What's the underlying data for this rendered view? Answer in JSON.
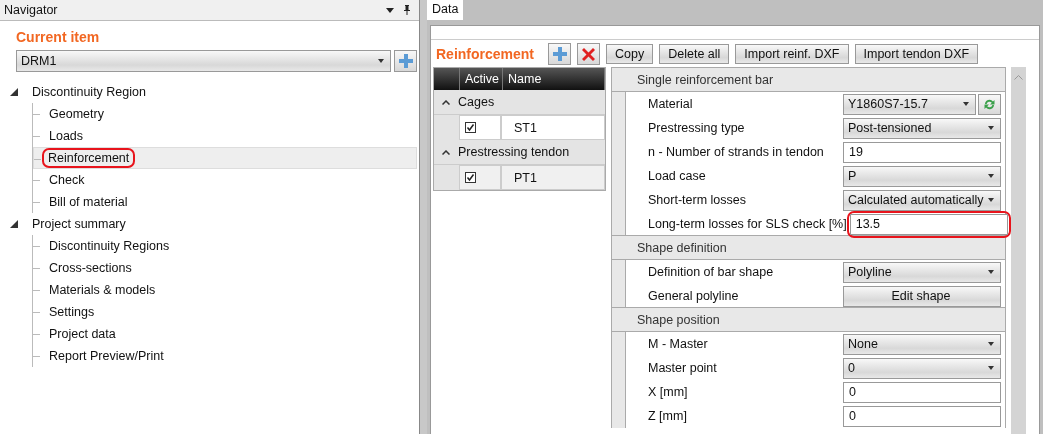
{
  "navigator": {
    "title": "Navigator",
    "current_item_label": "Current item",
    "current_item_value": "DRM1",
    "tree": [
      {
        "label": "Discontinuity Region",
        "expanded": true,
        "selected": false,
        "highlighted": false,
        "children": [
          {
            "label": "Geometry",
            "selected": false,
            "highlighted": false
          },
          {
            "label": "Loads",
            "selected": false,
            "highlighted": false
          },
          {
            "label": "Reinforcement",
            "selected": true,
            "highlighted": true
          },
          {
            "label": "Check",
            "selected": false,
            "highlighted": false
          },
          {
            "label": "Bill of material",
            "selected": false,
            "highlighted": false
          }
        ]
      },
      {
        "label": "Project summary",
        "expanded": true,
        "selected": false,
        "highlighted": false,
        "children": [
          {
            "label": "Discontinuity Regions",
            "selected": false,
            "highlighted": false
          },
          {
            "label": "Cross-sections",
            "selected": false,
            "highlighted": false
          },
          {
            "label": "Materials & models",
            "selected": false,
            "highlighted": false
          },
          {
            "label": "Settings",
            "selected": false,
            "highlighted": false
          },
          {
            "label": "Project data",
            "selected": false,
            "highlighted": false
          },
          {
            "label": "Report Preview/Print",
            "selected": false,
            "highlighted": false
          }
        ]
      }
    ]
  },
  "data_panel": {
    "tabs": [
      {
        "label": "Data",
        "selected": true
      }
    ],
    "title": "Reinforcement",
    "toolbar": [
      {
        "kind": "add"
      },
      {
        "kind": "delete"
      },
      {
        "kind": "text",
        "label": "Copy"
      },
      {
        "kind": "text",
        "label": "Delete all"
      },
      {
        "kind": "text",
        "label": "Import reinf. DXF"
      },
      {
        "kind": "text",
        "label": "Import tendon DXF"
      }
    ],
    "table": {
      "columns": [
        "Active",
        "Name"
      ],
      "groups": [
        {
          "label": "Cages",
          "expanded": true,
          "rows": [
            {
              "active": true,
              "name": "ST1",
              "selected": false
            }
          ]
        },
        {
          "label": "Prestressing tendon",
          "expanded": true,
          "rows": [
            {
              "active": true,
              "name": "PT1",
              "selected": true
            }
          ]
        }
      ]
    },
    "properties": [
      {
        "kind": "section",
        "label": "Single reinforcement bar"
      },
      {
        "kind": "dropdown",
        "label": "Material",
        "value": "Y1860S7-15.7",
        "refresh": true,
        "highlighted": false
      },
      {
        "kind": "dropdown",
        "label": "Prestressing type",
        "value": "Post-tensioned",
        "highlighted": false
      },
      {
        "kind": "text",
        "label": "n - Number of strands in tendon",
        "value": "19",
        "highlighted": false
      },
      {
        "kind": "dropdown",
        "label": "Load case",
        "value": "P",
        "highlighted": false
      },
      {
        "kind": "dropdown",
        "label": "Short-term losses",
        "value": "Calculated automatically",
        "highlighted": false
      },
      {
        "kind": "text",
        "label": "Long-term losses for SLS check [%]",
        "value": "13.5",
        "highlighted": true
      },
      {
        "kind": "section",
        "label": "Shape definition"
      },
      {
        "kind": "dropdown",
        "label": "Definition of bar shape",
        "value": "Polyline",
        "highlighted": false
      },
      {
        "kind": "button",
        "label": "General polyline",
        "value": "Edit shape",
        "highlighted": false
      },
      {
        "kind": "section",
        "label": "Shape position"
      },
      {
        "kind": "dropdown",
        "label": "M - Master",
        "value": "None",
        "highlighted": false
      },
      {
        "kind": "dropdown",
        "label": "Master point",
        "value": "0",
        "highlighted": false
      },
      {
        "kind": "text",
        "label": "X [mm]",
        "value": "0",
        "highlighted": false
      },
      {
        "kind": "text",
        "label": "Z [mm]",
        "value": "0",
        "highlighted": false
      }
    ]
  }
}
